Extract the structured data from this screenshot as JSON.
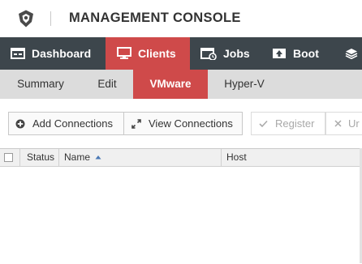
{
  "header": {
    "title": "MANAGEMENT CONSOLE",
    "logo_icon": "shield-logo-icon"
  },
  "nav": {
    "items": [
      {
        "label": "Dashboard",
        "icon": "dashboard-icon",
        "active": false
      },
      {
        "label": "Clients",
        "icon": "monitor-icon",
        "active": true
      },
      {
        "label": "Jobs",
        "icon": "calendar-icon",
        "active": false
      },
      {
        "label": "Boot",
        "icon": "boot-icon",
        "active": false
      },
      {
        "label": "",
        "icon": "layers-icon",
        "active": false
      }
    ]
  },
  "subnav": {
    "items": [
      {
        "label": "Summary",
        "active": false
      },
      {
        "label": "Edit",
        "active": false
      },
      {
        "label": "VMware",
        "active": true
      },
      {
        "label": "Hyper-V",
        "active": false
      }
    ]
  },
  "toolbar": {
    "add_connections": "Add Connections",
    "view_connections": "View Connections",
    "register": "Register",
    "unregister_truncated": "Ur"
  },
  "table": {
    "columns": [
      "Status",
      "Name",
      "Host"
    ],
    "sort_column": "Name",
    "sort_direction": "ascending",
    "rows": []
  },
  "colors": {
    "nav_bg": "#3d464c",
    "accent": "#cf4a4a",
    "subnav_bg": "#dcdcdc"
  }
}
